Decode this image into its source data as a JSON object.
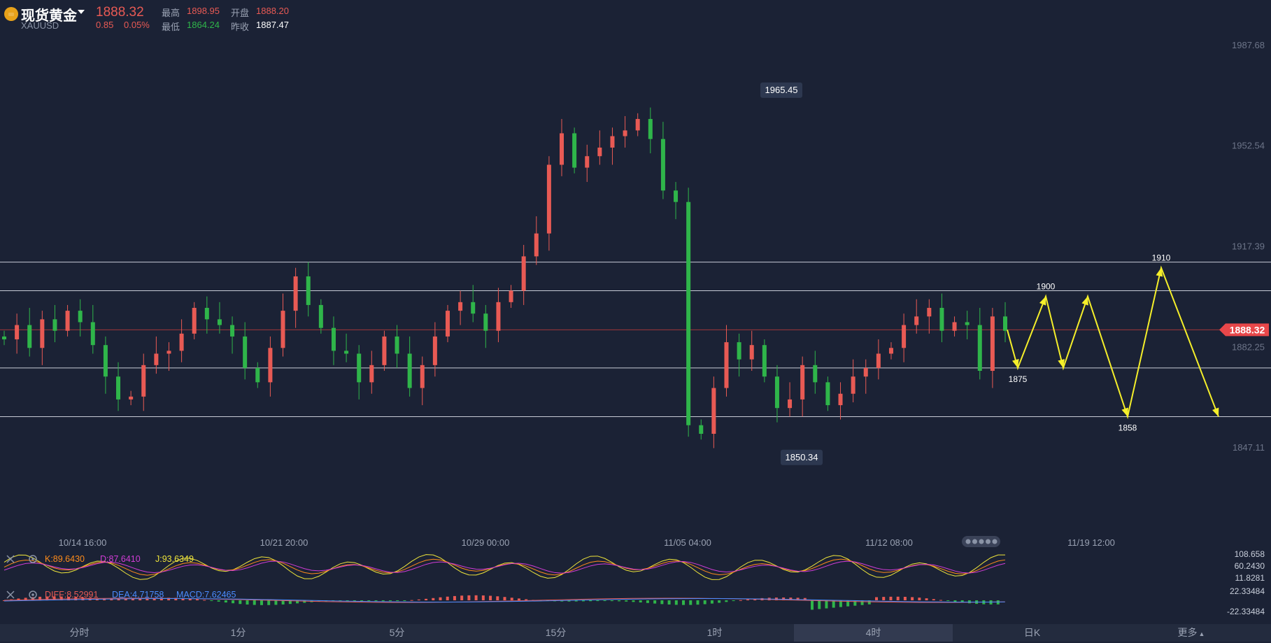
{
  "header": {
    "name": "现货黄金",
    "symbol": "XAUUSD",
    "price": "1888.32",
    "change": "0.85",
    "change_pct": "0.05%",
    "high_label": "最高",
    "high": "1898.95",
    "open_label": "开盘",
    "open": "1888.20",
    "low_label": "最低",
    "low": "1864.24",
    "prev_label": "昨收",
    "prev": "1887.47"
  },
  "colors": {
    "up": "#e85a54",
    "down": "#2fb54a",
    "background": "#1b2235",
    "projection": "#f5ef2a"
  },
  "chart_data": {
    "type": "candlestick",
    "price_axis_labels": [
      "1987.68",
      "1952.54",
      "1917.39",
      "1882.25",
      "1847.11"
    ],
    "ylim": [
      1830,
      2000
    ],
    "current_price_tag": "1888.32",
    "time_labels": [
      "10/14 16:00",
      "10/21 20:00",
      "10/29 00:00",
      "11/05 04:00",
      "11/12 08:00",
      "11/19 12:00"
    ],
    "max_marker": "1965.45",
    "min_marker": "1850.34",
    "horizontal_levels": [
      1912,
      1902,
      1875,
      1858
    ],
    "projection_labels": [
      "1900",
      "1875",
      "1910",
      "1858"
    ],
    "projection_path": [
      1888.32,
      1875,
      1900,
      1875,
      1900,
      1858,
      1910,
      1858
    ],
    "candles_close": [
      1885,
      1890,
      1882,
      1892,
      1888,
      1895,
      1891,
      1883,
      1872,
      1864,
      1865,
      1876,
      1880,
      1881,
      1887,
      1896,
      1892,
      1890,
      1886,
      1875,
      1870,
      1882,
      1895,
      1907,
      1897,
      1889,
      1881,
      1880,
      1870,
      1876,
      1886,
      1880,
      1868,
      1876,
      1886,
      1895,
      1898,
      1894,
      1888,
      1898,
      1902,
      1914,
      1922,
      1946,
      1957,
      1945,
      1949,
      1952,
      1956,
      1958,
      1962,
      1955,
      1937,
      1933,
      1855,
      1852,
      1868,
      1884,
      1878,
      1883,
      1872,
      1861,
      1864,
      1876,
      1870,
      1862,
      1866,
      1872,
      1875,
      1880,
      1882,
      1890,
      1893,
      1896,
      1888,
      1891,
      1890,
      1874,
      1893,
      1888
    ]
  },
  "kdj": {
    "k_label": "K:89.6430",
    "d_label": "D:87.6410",
    "j_label": "J:93.6349",
    "axis": [
      "108.658",
      "60.2430",
      "11.8281"
    ]
  },
  "macd": {
    "diff_label": "DIFF:8.52991",
    "dea_label": "DEA:4.71758",
    "macd_label": "MACD:7.62465",
    "axis": [
      "22.33484",
      "-22.33484"
    ]
  },
  "tabs": [
    "分时",
    "1分",
    "5分",
    "15分",
    "1时",
    "4时",
    "日K",
    "更多"
  ],
  "active_tab": "4时"
}
